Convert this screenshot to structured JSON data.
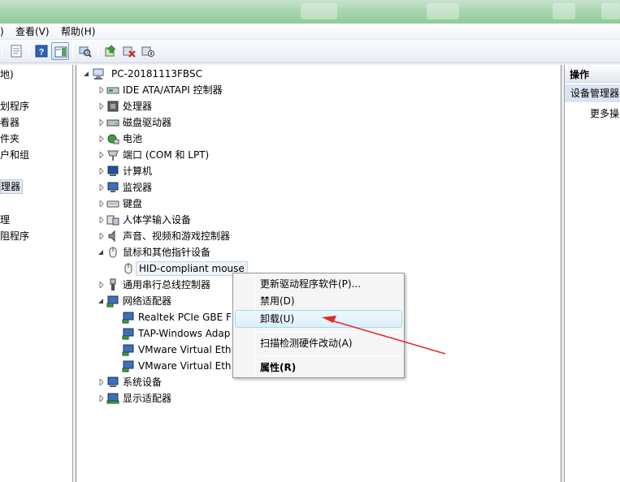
{
  "menubar": {
    "items": [
      ")",
      "查看(V)",
      "帮助(H)"
    ]
  },
  "left_pane": {
    "items": [
      "地)",
      "划程序",
      "看器",
      "件夹",
      "户和组",
      "理器",
      "理",
      "阻程序"
    ]
  },
  "tree": {
    "root": "PC-20181113FBSC",
    "rows": [
      {
        "label": "IDE ATA/ATAPI 控制器",
        "icon": "ide-controller-icon"
      },
      {
        "label": "处理器",
        "icon": "processor-icon"
      },
      {
        "label": "磁盘驱动器",
        "icon": "disk-drive-icon"
      },
      {
        "label": "电池",
        "icon": "battery-icon"
      },
      {
        "label": "端口 (COM 和 LPT)",
        "icon": "port-icon"
      },
      {
        "label": "计算机",
        "icon": "computer-icon"
      },
      {
        "label": "监视器",
        "icon": "monitor-icon"
      },
      {
        "label": "键盘",
        "icon": "keyboard-icon"
      },
      {
        "label": "人体学输入设备",
        "icon": "hid-icon"
      },
      {
        "label": "声音、视频和游戏控制器",
        "icon": "speaker-icon"
      },
      {
        "label": "鼠标和其他指针设备",
        "icon": "mouse-icon"
      },
      {
        "label": "HID-compliant mouse",
        "icon": "mouse-icon"
      },
      {
        "label": "通用串行总线控制器",
        "icon": "usb-icon"
      },
      {
        "label": "网络适配器",
        "icon": "network-adapter-icon"
      },
      {
        "label": "Realtek PCIe GBE F",
        "icon": "network-card-icon"
      },
      {
        "label": "TAP-Windows Adap",
        "icon": "network-card-icon"
      },
      {
        "label": "VMware Virtual Eth",
        "icon": "network-card-icon"
      },
      {
        "label": "VMware Virtual Eth",
        "icon": "network-card-icon"
      },
      {
        "label": "系统设备",
        "icon": "system-device-icon"
      },
      {
        "label": "显示适配器",
        "icon": "display-adapter-icon"
      }
    ]
  },
  "context_menu": {
    "items": [
      "更新驱动程序软件(P)...",
      "禁用(D)",
      "卸载(U)",
      "扫描检测硬件改动(A)",
      "属性(R)"
    ]
  },
  "actions_pane": {
    "header": "操作",
    "selected": "设备管理器",
    "more": "更多操"
  },
  "colors": {
    "titlebar": "#a9d6b1",
    "selection": "#d9e4f2",
    "menu_hover": "#dceff9",
    "annotation_arrow": "#e02c2c"
  }
}
